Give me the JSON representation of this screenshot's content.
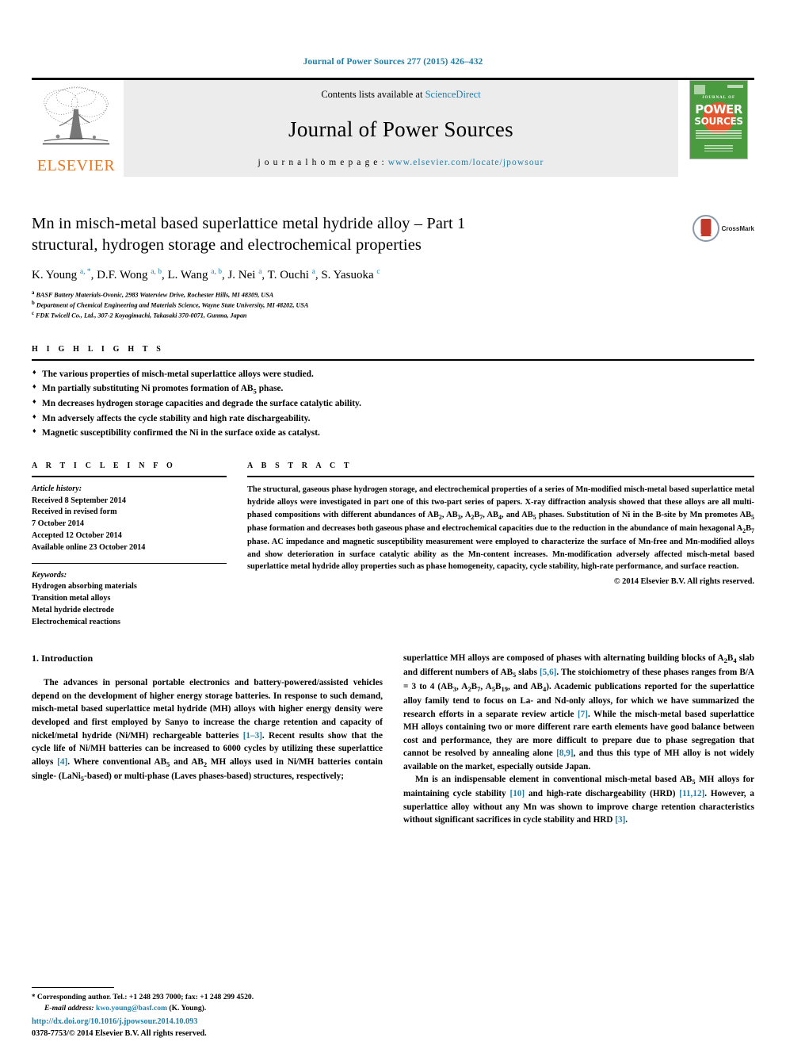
{
  "running_head": "Journal of Power Sources 277 (2015) 426–432",
  "masthead": {
    "publisher_logo_text": "ELSEVIER",
    "contents_prefix": "Contents lists available at ",
    "contents_link": "ScienceDirect",
    "journal_name": "Journal of Power Sources",
    "homepage_prefix": "j o u r n a l   h o m e p a g e :   ",
    "homepage_url": "www.elsevier.com/locate/jpowsour",
    "cover": {
      "journal_of": "JOURNAL OF",
      "word1": "POWER",
      "word2": "SOURCES"
    }
  },
  "article": {
    "title_line1": "Mn in misch-metal based superlattice metal hydride alloy – Part 1",
    "title_line2": "structural, hydrogen storage and electrochemical properties",
    "crossmark_label": "CrossMark",
    "authors": [
      {
        "name": "K. Young",
        "marks": "a, *"
      },
      {
        "name": "D.F. Wong",
        "marks": "a, b"
      },
      {
        "name": "L. Wang",
        "marks": "a, b"
      },
      {
        "name": "J. Nei",
        "marks": "a"
      },
      {
        "name": "T. Ouchi",
        "marks": "a"
      },
      {
        "name": "S. Yasuoka",
        "marks": "c"
      }
    ],
    "affiliations": [
      {
        "mark": "a",
        "text": "BASF Battery Materials-Ovonic, 2983 Waterview Drive, Rochester Hills, MI 48309, USA"
      },
      {
        "mark": "b",
        "text": "Department of Chemical Engineering and Materials Science, Wayne State University, MI 48202, USA"
      },
      {
        "mark": "c",
        "text": "FDK Twicell Co., Ltd., 307-2 Koyagimachi, Takasaki 370-0071, Gunma, Japan"
      }
    ]
  },
  "highlights": {
    "heading": "H I G H L I G H T S",
    "items": [
      "The various properties of misch-metal superlattice alloys were studied.",
      "Mn partially substituting Ni promotes formation of AB5 phase.",
      "Mn decreases hydrogen storage capacities and degrade the surface catalytic ability.",
      "Mn adversely affects the cycle stability and high rate dischargeability.",
      "Magnetic susceptibility confirmed the Ni in the surface oxide as catalyst."
    ]
  },
  "article_info": {
    "heading": "A R T I C L E   I N F O",
    "history_label": "Article history:",
    "history": [
      "Received 8 September 2014",
      "Received in revised form",
      "7 October 2014",
      "Accepted 12 October 2014",
      "Available online 23 October 2014"
    ],
    "keywords_label": "Keywords:",
    "keywords": [
      "Hydrogen absorbing materials",
      "Transition metal alloys",
      "Metal hydride electrode",
      "Electrochemical reactions"
    ]
  },
  "abstract": {
    "heading": "A B S T R A C T",
    "text": "The structural, gaseous phase hydrogen storage, and electrochemical properties of a series of Mn-modified misch-metal based superlattice metal hydride alloys were investigated in part one of this two-part series of papers. X-ray diffraction analysis showed that these alloys are all multi-phased compositions with different abundances of AB2, AB3, A2B7, AB4, and AB5 phases. Substitution of Ni in the B-site by Mn promotes AB5 phase formation and decreases both gaseous phase and electrochemical capacities due to the reduction in the abundance of main hexagonal A2B7 phase. AC impedance and magnetic susceptibility measurement were employed to characterize the surface of Mn-free and Mn-modified alloys and show deterioration in surface catalytic ability as the Mn-content increases. Mn-modification adversely affected misch-metal based superlattice metal hydride alloy properties such as phase homogeneity, capacity, cycle stability, high-rate performance, and surface reaction.",
    "copyright": "© 2014 Elsevier B.V. All rights reserved."
  },
  "body": {
    "section_number_title": "1.  Introduction",
    "left_paragraph": "The advances in personal portable electronics and battery-powered/assisted vehicles depend on the development of higher energy storage batteries. In response to such demand, misch-metal based superlattice metal hydride (MH) alloys with higher energy density were developed and first employed by Sanyo to increase the charge retention and capacity of nickel/metal hydride (Ni/MH) rechargeable batteries [1–3]. Recent results show that the cycle life of Ni/MH batteries can be increased to 6000 cycles by utilizing these superlattice alloys [4]. Where conventional AB5 and AB2 MH alloys used in Ni/MH batteries contain single- (LaNi5-based) or multi-phase (Laves phases-based) structures, respectively;",
    "right_paragraph_1": "superlattice MH alloys are composed of phases with alternating building blocks of A2B4 slab and different numbers of AB5 slabs [5,6]. The stoichiometry of these phases ranges from B/A = 3 to 4 (AB3, A2B7, A5B19, and AB4). Academic publications reported for the superlattice alloy family tend to focus on La- and Nd-only alloys, for which we have summarized the research efforts in a separate review article [7]. While the misch-metal based superlattice MH alloys containing two or more different rare earth elements have good balance between cost and performance, they are more difficult to prepare due to phase segregation that cannot be resolved by annealing alone [8,9], and thus this type of MH alloy is not widely available on the market, especially outside Japan.",
    "right_paragraph_2": "Mn is an indispensable element in conventional misch-metal based AB5 MH alloys for maintaining cycle stability [10] and high-rate dischargeability (HRD) [11,12]. However, a superlattice alloy without any Mn was shown to improve charge retention characteristics without significant sacrifices in cycle stability and HRD [3]."
  },
  "footer": {
    "corresponding_note": "Corresponding author. Tel.: +1 248 293 7000; fax: +1 248 299 4520.",
    "email_label": "E-mail address:",
    "email": "kwo.young@basf.com",
    "email_suffix": "(K. Young).",
    "doi": "http://dx.doi.org/10.1016/j.jpowsour.2014.10.093",
    "issn_line": "0378-7753/© 2014 Elsevier B.V. All rights reserved."
  },
  "colors": {
    "link_blue": "#1f7ea8",
    "elsevier_orange": "#E87722",
    "cover_green": "#4a9a3f",
    "cover_sun": "#e4572e",
    "crossmark_red": "#c0392b",
    "masthead_gray": "#ececec"
  }
}
